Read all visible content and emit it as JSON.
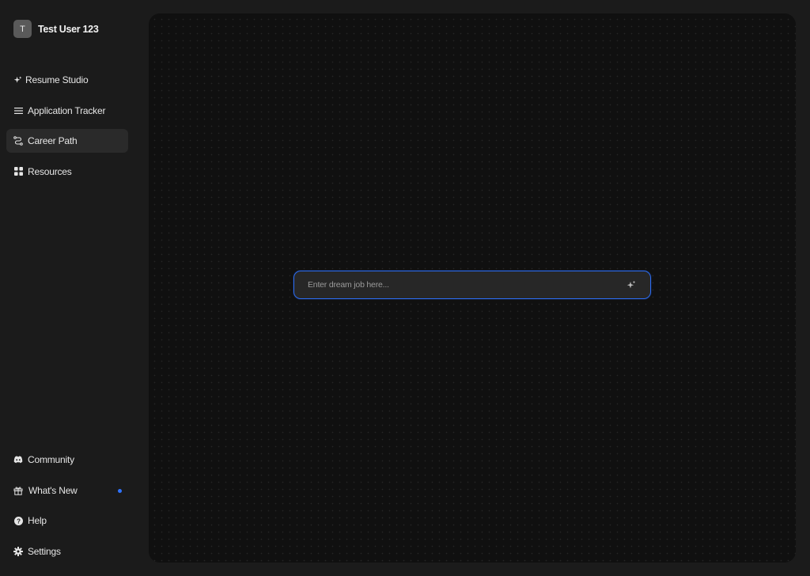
{
  "user": {
    "initial": "T",
    "name": "Test User 123"
  },
  "nav_top": [
    {
      "label": "Resume Studio",
      "icon": "sparkle-icon"
    },
    {
      "label": "Application Tracker",
      "icon": "menu-lines-icon"
    },
    {
      "label": "Career Path",
      "icon": "path-icon",
      "active": true
    },
    {
      "label": "Resources",
      "icon": "grid-icon"
    }
  ],
  "nav_bottom": [
    {
      "label": "Community",
      "icon": "discord-icon"
    },
    {
      "label": "What's New",
      "icon": "gift-icon",
      "badge": true
    },
    {
      "label": "Help",
      "icon": "help-circle-icon"
    },
    {
      "label": "Settings",
      "icon": "gear-icon"
    }
  ],
  "search": {
    "placeholder": "Enter dream job here...",
    "value": ""
  },
  "colors": {
    "accent": "#2c6cf0",
    "badge": "#2f73ff",
    "sidebar_bg": "#1b1b1b",
    "panel_bg": "#101010"
  }
}
